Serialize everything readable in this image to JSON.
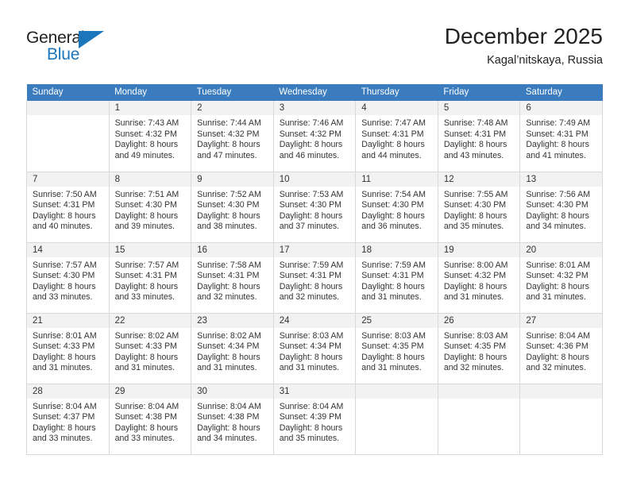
{
  "brand": {
    "name_top": "General",
    "name_bottom": "Blue",
    "flag_color": "#1b76bc"
  },
  "header": {
    "title": "December 2025",
    "subtitle": "Kagal’nitskaya, Russia"
  },
  "calendar": {
    "header_color": "#3a7cbe",
    "weekday_headers": [
      "Sunday",
      "Monday",
      "Tuesday",
      "Wednesday",
      "Thursday",
      "Friday",
      "Saturday"
    ],
    "weeks": [
      [
        {
          "empty": true
        },
        {
          "day": "1",
          "sunrise": "Sunrise: 7:43 AM",
          "sunset": "Sunset: 4:32 PM",
          "daylight1": "Daylight: 8 hours",
          "daylight2": "and 49 minutes."
        },
        {
          "day": "2",
          "sunrise": "Sunrise: 7:44 AM",
          "sunset": "Sunset: 4:32 PM",
          "daylight1": "Daylight: 8 hours",
          "daylight2": "and 47 minutes."
        },
        {
          "day": "3",
          "sunrise": "Sunrise: 7:46 AM",
          "sunset": "Sunset: 4:32 PM",
          "daylight1": "Daylight: 8 hours",
          "daylight2": "and 46 minutes."
        },
        {
          "day": "4",
          "sunrise": "Sunrise: 7:47 AM",
          "sunset": "Sunset: 4:31 PM",
          "daylight1": "Daylight: 8 hours",
          "daylight2": "and 44 minutes."
        },
        {
          "day": "5",
          "sunrise": "Sunrise: 7:48 AM",
          "sunset": "Sunset: 4:31 PM",
          "daylight1": "Daylight: 8 hours",
          "daylight2": "and 43 minutes."
        },
        {
          "day": "6",
          "sunrise": "Sunrise: 7:49 AM",
          "sunset": "Sunset: 4:31 PM",
          "daylight1": "Daylight: 8 hours",
          "daylight2": "and 41 minutes."
        }
      ],
      [
        {
          "day": "7",
          "sunrise": "Sunrise: 7:50 AM",
          "sunset": "Sunset: 4:31 PM",
          "daylight1": "Daylight: 8 hours",
          "daylight2": "and 40 minutes."
        },
        {
          "day": "8",
          "sunrise": "Sunrise: 7:51 AM",
          "sunset": "Sunset: 4:30 PM",
          "daylight1": "Daylight: 8 hours",
          "daylight2": "and 39 minutes."
        },
        {
          "day": "9",
          "sunrise": "Sunrise: 7:52 AM",
          "sunset": "Sunset: 4:30 PM",
          "daylight1": "Daylight: 8 hours",
          "daylight2": "and 38 minutes."
        },
        {
          "day": "10",
          "sunrise": "Sunrise: 7:53 AM",
          "sunset": "Sunset: 4:30 PM",
          "daylight1": "Daylight: 8 hours",
          "daylight2": "and 37 minutes."
        },
        {
          "day": "11",
          "sunrise": "Sunrise: 7:54 AM",
          "sunset": "Sunset: 4:30 PM",
          "daylight1": "Daylight: 8 hours",
          "daylight2": "and 36 minutes."
        },
        {
          "day": "12",
          "sunrise": "Sunrise: 7:55 AM",
          "sunset": "Sunset: 4:30 PM",
          "daylight1": "Daylight: 8 hours",
          "daylight2": "and 35 minutes."
        },
        {
          "day": "13",
          "sunrise": "Sunrise: 7:56 AM",
          "sunset": "Sunset: 4:30 PM",
          "daylight1": "Daylight: 8 hours",
          "daylight2": "and 34 minutes."
        }
      ],
      [
        {
          "day": "14",
          "sunrise": "Sunrise: 7:57 AM",
          "sunset": "Sunset: 4:30 PM",
          "daylight1": "Daylight: 8 hours",
          "daylight2": "and 33 minutes."
        },
        {
          "day": "15",
          "sunrise": "Sunrise: 7:57 AM",
          "sunset": "Sunset: 4:31 PM",
          "daylight1": "Daylight: 8 hours",
          "daylight2": "and 33 minutes."
        },
        {
          "day": "16",
          "sunrise": "Sunrise: 7:58 AM",
          "sunset": "Sunset: 4:31 PM",
          "daylight1": "Daylight: 8 hours",
          "daylight2": "and 32 minutes."
        },
        {
          "day": "17",
          "sunrise": "Sunrise: 7:59 AM",
          "sunset": "Sunset: 4:31 PM",
          "daylight1": "Daylight: 8 hours",
          "daylight2": "and 32 minutes."
        },
        {
          "day": "18",
          "sunrise": "Sunrise: 7:59 AM",
          "sunset": "Sunset: 4:31 PM",
          "daylight1": "Daylight: 8 hours",
          "daylight2": "and 31 minutes."
        },
        {
          "day": "19",
          "sunrise": "Sunrise: 8:00 AM",
          "sunset": "Sunset: 4:32 PM",
          "daylight1": "Daylight: 8 hours",
          "daylight2": "and 31 minutes."
        },
        {
          "day": "20",
          "sunrise": "Sunrise: 8:01 AM",
          "sunset": "Sunset: 4:32 PM",
          "daylight1": "Daylight: 8 hours",
          "daylight2": "and 31 minutes."
        }
      ],
      [
        {
          "day": "21",
          "sunrise": "Sunrise: 8:01 AM",
          "sunset": "Sunset: 4:33 PM",
          "daylight1": "Daylight: 8 hours",
          "daylight2": "and 31 minutes."
        },
        {
          "day": "22",
          "sunrise": "Sunrise: 8:02 AM",
          "sunset": "Sunset: 4:33 PM",
          "daylight1": "Daylight: 8 hours",
          "daylight2": "and 31 minutes."
        },
        {
          "day": "23",
          "sunrise": "Sunrise: 8:02 AM",
          "sunset": "Sunset: 4:34 PM",
          "daylight1": "Daylight: 8 hours",
          "daylight2": "and 31 minutes."
        },
        {
          "day": "24",
          "sunrise": "Sunrise: 8:03 AM",
          "sunset": "Sunset: 4:34 PM",
          "daylight1": "Daylight: 8 hours",
          "daylight2": "and 31 minutes."
        },
        {
          "day": "25",
          "sunrise": "Sunrise: 8:03 AM",
          "sunset": "Sunset: 4:35 PM",
          "daylight1": "Daylight: 8 hours",
          "daylight2": "and 31 minutes."
        },
        {
          "day": "26",
          "sunrise": "Sunrise: 8:03 AM",
          "sunset": "Sunset: 4:35 PM",
          "daylight1": "Daylight: 8 hours",
          "daylight2": "and 32 minutes."
        },
        {
          "day": "27",
          "sunrise": "Sunrise: 8:04 AM",
          "sunset": "Sunset: 4:36 PM",
          "daylight1": "Daylight: 8 hours",
          "daylight2": "and 32 minutes."
        }
      ],
      [
        {
          "day": "28",
          "sunrise": "Sunrise: 8:04 AM",
          "sunset": "Sunset: 4:37 PM",
          "daylight1": "Daylight: 8 hours",
          "daylight2": "and 33 minutes."
        },
        {
          "day": "29",
          "sunrise": "Sunrise: 8:04 AM",
          "sunset": "Sunset: 4:38 PM",
          "daylight1": "Daylight: 8 hours",
          "daylight2": "and 33 minutes."
        },
        {
          "day": "30",
          "sunrise": "Sunrise: 8:04 AM",
          "sunset": "Sunset: 4:38 PM",
          "daylight1": "Daylight: 8 hours",
          "daylight2": "and 34 minutes."
        },
        {
          "day": "31",
          "sunrise": "Sunrise: 8:04 AM",
          "sunset": "Sunset: 4:39 PM",
          "daylight1": "Daylight: 8 hours",
          "daylight2": "and 35 minutes."
        },
        {
          "empty": true
        },
        {
          "empty": true
        },
        {
          "empty": true
        }
      ]
    ]
  }
}
